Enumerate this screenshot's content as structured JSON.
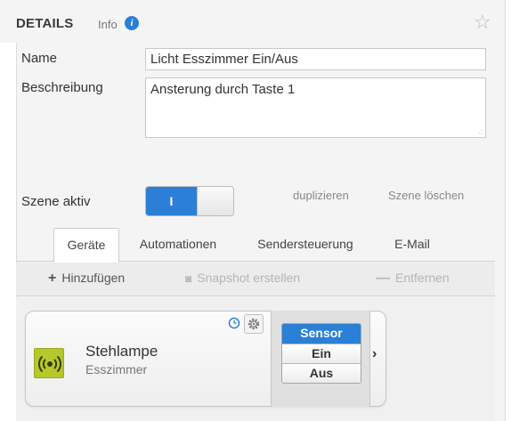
{
  "details": {
    "title": "DETAILS",
    "info_label": "Info",
    "name_label": "Name",
    "name_value": "Licht Esszimmer Ein/Aus",
    "description_label": "Beschreibung",
    "description_value": "Ansterung durch Taste 1",
    "scene_active_label": "Szene aktiv",
    "toggle_label": "I",
    "duplicate_link": "duplizieren",
    "delete_link": "Szene löschen"
  },
  "tabs": [
    {
      "label": "Geräte",
      "active": true
    },
    {
      "label": "Automationen",
      "active": false
    },
    {
      "label": "Sendersteuerung",
      "active": false
    },
    {
      "label": "E-Mail",
      "active": false
    }
  ],
  "toolbar": {
    "add": "Hinzufügen",
    "snapshot": "Snapshot erstellen",
    "remove": "Entfernen"
  },
  "device": {
    "name": "Stehlampe",
    "room": "Esszimmer",
    "actions": [
      "Sensor",
      "Ein",
      "Aus"
    ]
  },
  "colors": {
    "accent": "#2b7fd6",
    "device_icon": "#b6c82b"
  },
  "icons": {
    "info": "info-icon",
    "favorite": "star-icon",
    "add": "plus-icon",
    "snapshot": "camera-icon",
    "remove": "minus-icon",
    "device": "sensor-icon",
    "schedule": "clock-icon",
    "settings": "gear-icon",
    "expand": "chevron-right-icon"
  }
}
